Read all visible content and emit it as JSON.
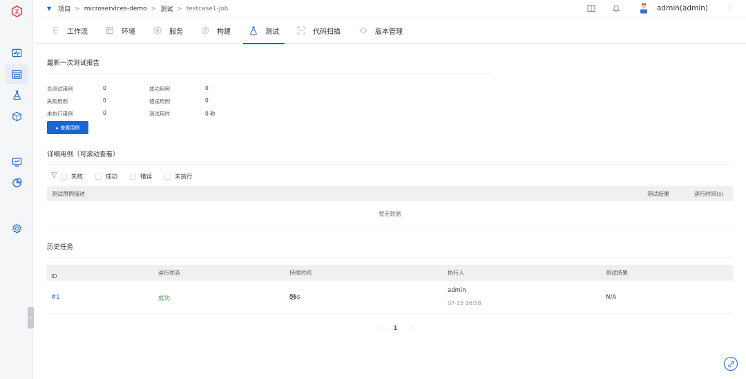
{
  "breadcrumb": {
    "items": [
      "项目",
      "microservices-demo",
      "测试",
      "testcase1-job"
    ],
    "separator": ">"
  },
  "header": {
    "username": "admin(admin)",
    "icons": [
      "book-icon",
      "bell-icon",
      "user-avatar",
      "more-icon"
    ]
  },
  "rail": {
    "icons": [
      "logo-icon",
      "pulse-monitor-icon",
      "project-icon",
      "flask-icon",
      "package-icon",
      "monitor-icon",
      "pie-chart-icon",
      "settings-icon"
    ],
    "active": "project-icon"
  },
  "tabs": [
    {
      "label": "工作流",
      "icon": "workflow-icon"
    },
    {
      "label": "环境",
      "icon": "environment-icon"
    },
    {
      "label": "服务",
      "icon": "service-icon"
    },
    {
      "label": "构建",
      "icon": "build-icon"
    },
    {
      "label": "测试",
      "icon": "flask-icon",
      "active": true
    },
    {
      "label": "代码扫描",
      "icon": "scan-icon"
    },
    {
      "label": "版本管理",
      "icon": "version-icon"
    }
  ],
  "latest_report": {
    "title": "最新一次测试报告",
    "stats": [
      {
        "label": "总测试用例",
        "value": "0"
      },
      {
        "label": "成功用例",
        "value": "0"
      },
      {
        "label": "失败用例",
        "value": "0"
      },
      {
        "label": "错误用例",
        "value": "0"
      },
      {
        "label": "未执行用例",
        "value": "0"
      },
      {
        "label": "测试用时",
        "value": "0 秒"
      }
    ],
    "view_button": "查看用例"
  },
  "detail_cases": {
    "title": "详细用例（可滚动查看）",
    "filters": [
      "失败",
      "成功",
      "错误",
      "未执行"
    ],
    "columns": [
      "测试用例描述",
      "测试结果",
      "运行时间(s)"
    ],
    "empty_text": "暂无数据"
  },
  "history": {
    "title": "历史任务",
    "columns": [
      "ID",
      "运行状态",
      "持续时间",
      "执行人",
      "测试结果"
    ],
    "rows": [
      {
        "id": "#1",
        "status": "成功",
        "duration": "56s",
        "executor": "admin",
        "time": "07-15 16:58",
        "result": "N/A"
      }
    ],
    "pagination": {
      "current": "1",
      "prev": "‹",
      "next": "›"
    }
  },
  "colors": {
    "accent": "#1a64d6",
    "success": "#4aa64a"
  }
}
